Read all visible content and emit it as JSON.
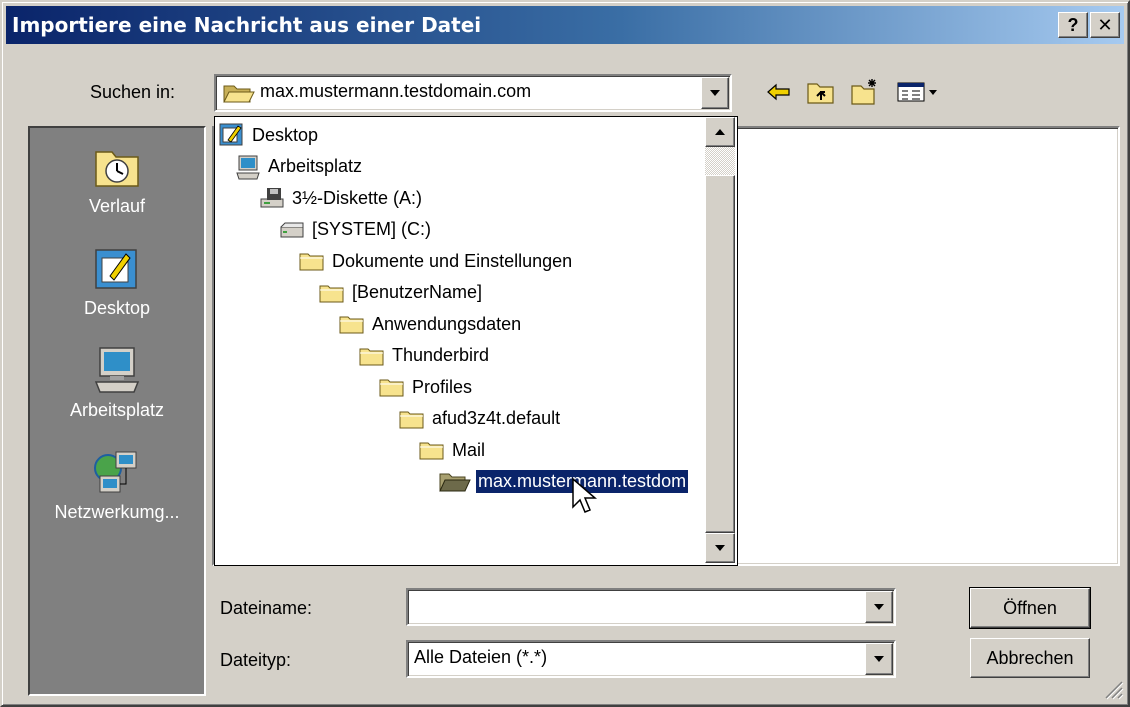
{
  "window": {
    "title": "Importiere eine Nachricht aus einer Datei",
    "help_label": "?",
    "close_label": "✕"
  },
  "look_in": {
    "label": "Suchen in:",
    "value": "max.mustermann.testdomain.com"
  },
  "places": [
    {
      "label": "Verlauf",
      "icon": "history-icon"
    },
    {
      "label": "Desktop",
      "icon": "desktop-icon"
    },
    {
      "label": "Arbeitsplatz",
      "icon": "my-computer-icon"
    },
    {
      "label": "Netzwerkumg...",
      "icon": "network-icon"
    }
  ],
  "tree": [
    {
      "label": "Desktop",
      "icon": "desktop-icon"
    },
    {
      "label": "Arbeitsplatz",
      "icon": "my-computer-icon"
    },
    {
      "label": "3½-Diskette (A:)",
      "icon": "floppy-drive-icon"
    },
    {
      "label": "[SYSTEM] (C:)",
      "icon": "hard-drive-icon"
    },
    {
      "label": "Dokumente und Einstellungen",
      "icon": "folder-icon"
    },
    {
      "label": "[BenutzerName]",
      "icon": "folder-icon"
    },
    {
      "label": "Anwendungsdaten",
      "icon": "folder-icon"
    },
    {
      "label": "Thunderbird",
      "icon": "folder-icon"
    },
    {
      "label": "Profiles",
      "icon": "folder-icon"
    },
    {
      "label": "afud3z4t.default",
      "icon": "folder-icon"
    },
    {
      "label": "Mail",
      "icon": "folder-icon"
    },
    {
      "label": "max.mustermann.testdom",
      "icon": "open-folder-icon",
      "selected": true
    }
  ],
  "filename": {
    "label": "Dateiname:",
    "value": ""
  },
  "filetype": {
    "label": "Dateityp:",
    "value": "Alle Dateien (*.*)"
  },
  "buttons": {
    "open": "Öffnen",
    "cancel": "Abbrechen"
  },
  "colors": {
    "title_start": "#0a246a",
    "title_end": "#a6caf0",
    "face": "#d4d0c8",
    "selection": "#0a246a"
  }
}
